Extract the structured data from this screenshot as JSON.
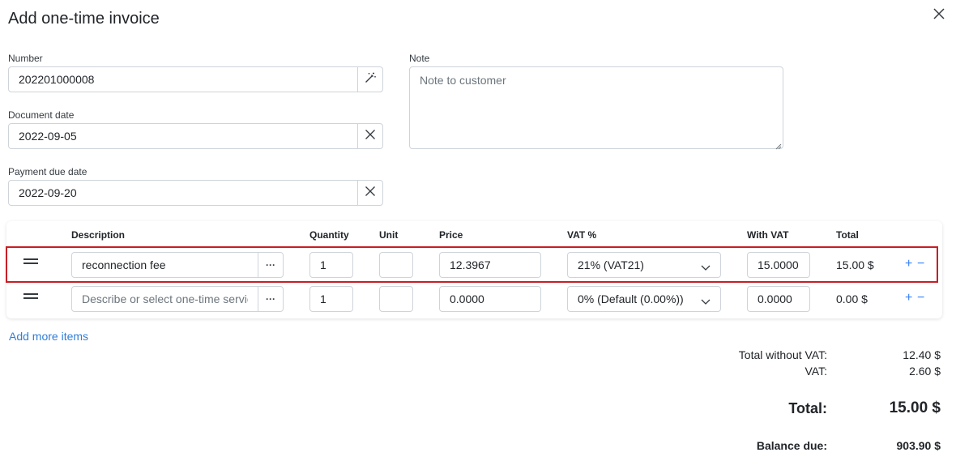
{
  "modal": {
    "title": "Add one-time invoice"
  },
  "form": {
    "number": {
      "label": "Number",
      "value": "202201000008"
    },
    "document_date": {
      "label": "Document date",
      "value": "2022-09-05"
    },
    "payment_due_date": {
      "label": "Payment due date",
      "value": "2022-09-20"
    },
    "note": {
      "label": "Note",
      "placeholder": "Note to customer",
      "value": ""
    }
  },
  "table": {
    "headers": {
      "description": "Description",
      "quantity": "Quantity",
      "unit": "Unit",
      "price": "Price",
      "vat": "VAT %",
      "with_vat": "With VAT",
      "total": "Total"
    },
    "rows": [
      {
        "description": "reconnection fee",
        "description_placeholder": "",
        "quantity": "1",
        "unit": "",
        "price": "12.3967",
        "vat": "21% (VAT21)",
        "with_vat": "15.0000",
        "total": "15.00 $"
      },
      {
        "description": "",
        "description_placeholder": "Describe or select one-time service",
        "quantity": "1",
        "unit": "",
        "price": "0.0000",
        "vat": "0% (Default (0.00%))",
        "with_vat": "0.0000",
        "total": "0.00 $"
      }
    ],
    "add_symbol": "+",
    "remove_symbol": "−",
    "more_symbol": "···"
  },
  "add_more_items": "Add more items",
  "summary": {
    "without_vat_label": "Total without VAT:",
    "without_vat_value": "12.40 $",
    "vat_label": "VAT:",
    "vat_value": "2.60 $",
    "total_label": "Total:",
    "total_value": "15.00 $",
    "balance_label": "Balance due:",
    "balance_value": "903.90 $"
  },
  "colors": {
    "accent": "#2f7ed8",
    "highlight_border": "#c81e25",
    "input_border": "#ced4da"
  },
  "icons": {
    "close": "close-icon",
    "generate": "magic-wand-icon",
    "clear": "clear-icon",
    "drag": "drag-handle-icon",
    "more": "more-icon",
    "dropdown": "chevron-down-icon"
  }
}
